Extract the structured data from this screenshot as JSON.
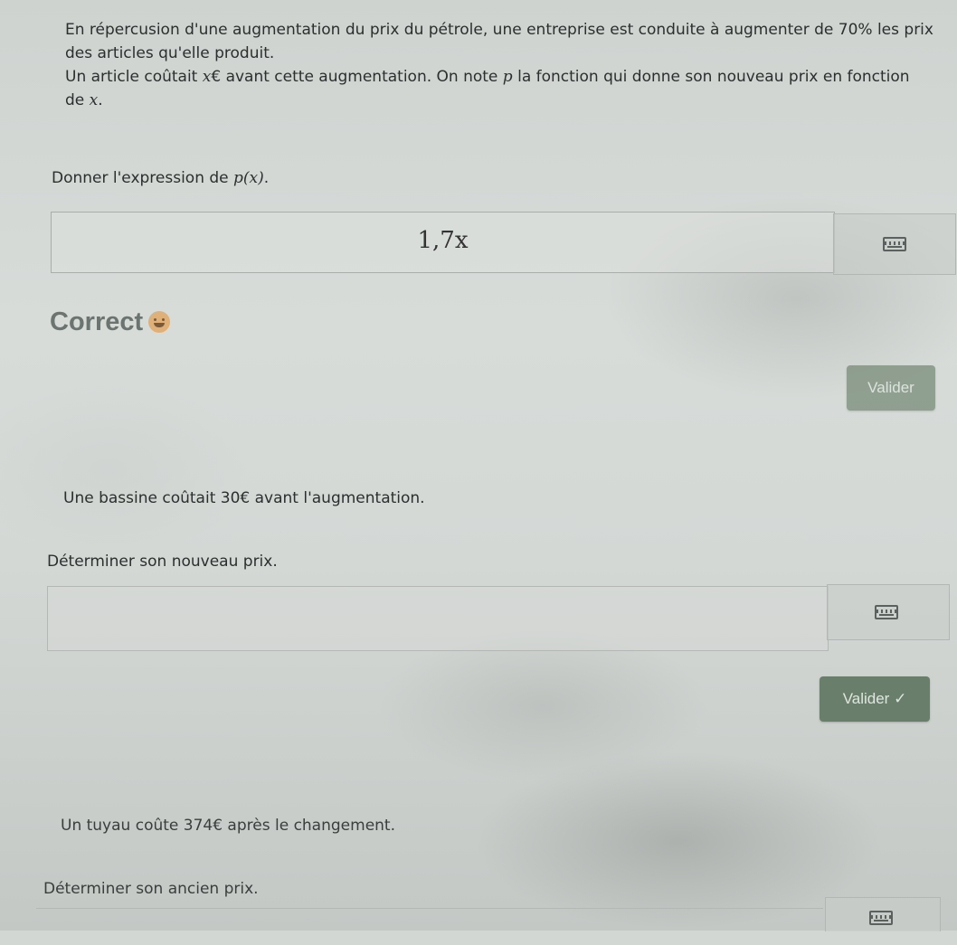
{
  "question1": {
    "line1": "En répercusion d'une augmentation du prix du pétrole, une entreprise est conduite à augmenter de 70% les prix des articles qu'elle produit.",
    "line2_pre": "Un article coûtait ",
    "line2_var": "x",
    "line2_post": "€ avant cette augmentation. On note ",
    "line2_fn": "p",
    "line2_post2": " la fonction qui donne son nouveau prix en fonction de ",
    "line2_var2": "x",
    "line2_end": ".",
    "ask_pre": "Donner l'expression de ",
    "ask_math": "p(x)",
    "ask_end": ".",
    "answer_value": "1,7x",
    "feedback": "Correct",
    "validate_label": "Valider"
  },
  "question2": {
    "statement": "Une bassine coûtait 30€ avant l'augmentation.",
    "ask": "Déterminer son nouveau prix.",
    "answer_value": "",
    "validate_label": "Valider ✓"
  },
  "question3": {
    "statement": "Un tuyau coûte 374€ après le changement.",
    "ask": "Déterminer son ancien prix."
  },
  "icons": {
    "keyboard": "keyboard-icon",
    "feedback": "smiley-icon"
  },
  "colors": {
    "button": "#788b78",
    "feedback_text": "#6b7470"
  }
}
